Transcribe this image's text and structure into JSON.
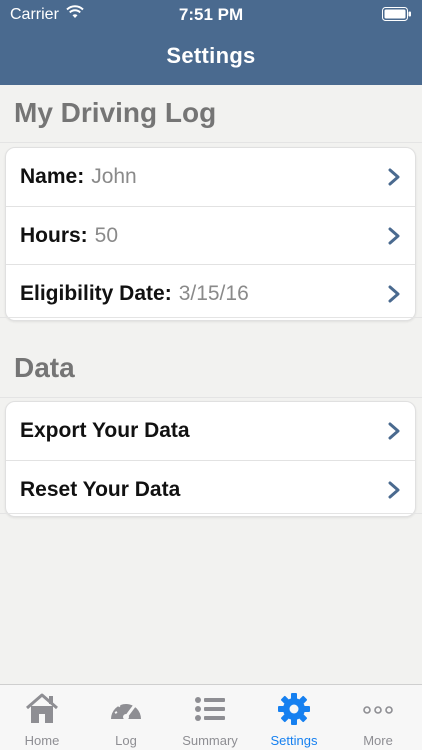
{
  "status_bar": {
    "carrier": "Carrier",
    "time": "7:51 PM"
  },
  "nav": {
    "title": "Settings"
  },
  "sections": {
    "driving_log": {
      "title": "My Driving Log",
      "rows": [
        {
          "label": "Name:",
          "value": "John"
        },
        {
          "label": "Hours:",
          "value": "50"
        },
        {
          "label": "Eligibility Date:",
          "value": "3/15/16"
        }
      ]
    },
    "data": {
      "title": "Data",
      "rows": [
        {
          "label": "Export Your Data"
        },
        {
          "label": "Reset Your Data"
        }
      ]
    }
  },
  "tabs": [
    {
      "label": "Home",
      "icon": "home-icon"
    },
    {
      "label": "Log",
      "icon": "gauge-icon"
    },
    {
      "label": "Summary",
      "icon": "list-icon"
    },
    {
      "label": "Settings",
      "icon": "gear-icon",
      "active": true
    },
    {
      "label": "More",
      "icon": "more-icon"
    }
  ],
  "colors": {
    "nav_bar": "#4a6a8f",
    "accent": "#1680f0",
    "chevron": "#4a6a8f"
  }
}
